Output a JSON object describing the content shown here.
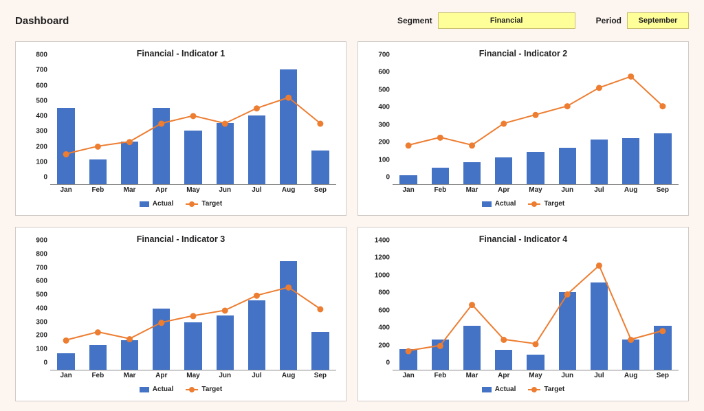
{
  "header": {
    "title": "Dashboard",
    "segment_label": "Segment",
    "segment_value": "Financial",
    "period_label": "Period",
    "period_value": "September"
  },
  "legend": {
    "actual": "Actual",
    "target": "Target"
  },
  "colors": {
    "bar": "#4472c4",
    "line": "#ed7d31"
  },
  "chart_data": [
    {
      "title": "Financial - Indicator 1",
      "type": "bar+line",
      "categories": [
        "Jan",
        "Feb",
        "Mar",
        "Apr",
        "May",
        "Jun",
        "Jul",
        "Aug",
        "Sep"
      ],
      "series": [
        {
          "name": "Actual",
          "kind": "bar",
          "values": [
            500,
            160,
            280,
            500,
            350,
            400,
            450,
            750,
            220
          ]
        },
        {
          "name": "Target",
          "kind": "line",
          "values": [
            200,
            250,
            280,
            400,
            450,
            400,
            500,
            570,
            400
          ]
        }
      ],
      "ylim": [
        0,
        800
      ],
      "ystep": 100
    },
    {
      "title": "Financial - Indicator 2",
      "type": "bar+line",
      "categories": [
        "Jan",
        "Feb",
        "Mar",
        "Apr",
        "May",
        "Jun",
        "Jul",
        "Aug",
        "Sep"
      ],
      "series": [
        {
          "name": "Actual",
          "kind": "bar",
          "values": [
            50,
            95,
            125,
            155,
            185,
            210,
            255,
            265,
            290
          ]
        },
        {
          "name": "Target",
          "kind": "line",
          "values": [
            225,
            270,
            225,
            350,
            400,
            450,
            555,
            620,
            450
          ]
        }
      ],
      "ylim": [
        0,
        700
      ],
      "ystep": 100
    },
    {
      "title": "Financial - Indicator 3",
      "type": "bar+line",
      "categories": [
        "Jan",
        "Feb",
        "Mar",
        "Apr",
        "May",
        "Jun",
        "Jul",
        "Aug",
        "Sep"
      ],
      "series": [
        {
          "name": "Actual",
          "kind": "bar",
          "values": [
            120,
            180,
            220,
            450,
            350,
            400,
            510,
            800,
            280
          ]
        },
        {
          "name": "Target",
          "kind": "line",
          "values": [
            220,
            280,
            230,
            350,
            400,
            440,
            550,
            610,
            450
          ]
        }
      ],
      "ylim": [
        0,
        900
      ],
      "ystep": 100
    },
    {
      "title": "Financial - Indicator 4",
      "type": "bar+line",
      "categories": [
        "Jan",
        "Feb",
        "Mar",
        "Apr",
        "May",
        "Jun",
        "Jul",
        "Aug",
        "Sep"
      ],
      "series": [
        {
          "name": "Actual",
          "kind": "bar",
          "values": [
            240,
            350,
            500,
            230,
            170,
            890,
            1000,
            350,
            500
          ]
        },
        {
          "name": "Target",
          "kind": "line",
          "values": [
            220,
            280,
            750,
            350,
            300,
            870,
            1200,
            350,
            450
          ]
        }
      ],
      "ylim": [
        0,
        1400
      ],
      "ystep": 200
    }
  ]
}
